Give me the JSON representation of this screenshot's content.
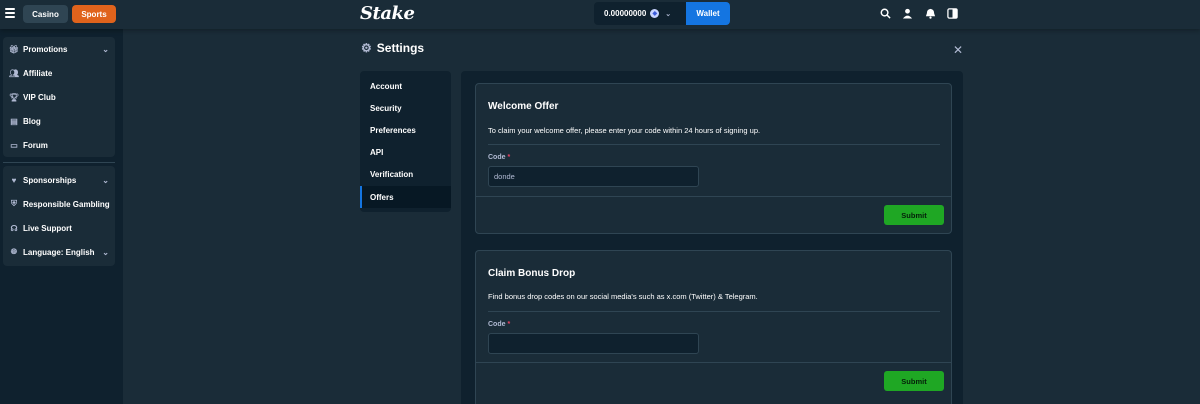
{
  "header": {
    "casino_label": "Casino",
    "sports_label": "Sports",
    "logo_text": "Stake",
    "balance": "0.00000000",
    "wallet_label": "Wallet",
    "accent": "#1475e1",
    "sports_color": "#e0631c"
  },
  "sidebar": {
    "group1": [
      {
        "label": "Promotions",
        "icon": "gift-icon",
        "expandable": true
      },
      {
        "label": "Affiliate",
        "icon": "affiliate-icon",
        "expandable": false
      },
      {
        "label": "VIP Club",
        "icon": "trophy-icon",
        "expandable": false
      },
      {
        "label": "Blog",
        "icon": "blog-icon",
        "expandable": false
      },
      {
        "label": "Forum",
        "icon": "forum-icon",
        "expandable": false
      }
    ],
    "group2": [
      {
        "label": "Sponsorships",
        "icon": "handshake-icon",
        "expandable": true
      },
      {
        "label": "Responsible Gambling",
        "icon": "shield-icon",
        "expandable": false
      },
      {
        "label": "Live Support",
        "icon": "headset-icon",
        "expandable": false
      },
      {
        "label": "Language: English",
        "icon": "globe-icon",
        "expandable": true
      }
    ]
  },
  "settings": {
    "title": "Settings",
    "menu": [
      {
        "label": "Account",
        "active": false
      },
      {
        "label": "Security",
        "active": false
      },
      {
        "label": "Preferences",
        "active": false
      },
      {
        "label": "API",
        "active": false
      },
      {
        "label": "Verification",
        "active": false
      },
      {
        "label": "Offers",
        "active": true
      }
    ]
  },
  "welcome_offer": {
    "title": "Welcome Offer",
    "description": "To claim your welcome offer, please enter your code within 24 hours of signing up.",
    "code_label": "Code",
    "required_mark": "*",
    "code_value": "donde",
    "submit_label": "Submit"
  },
  "bonus_drop": {
    "title": "Claim Bonus Drop",
    "description": "Find bonus drop codes on our social media's such as x.com (Twitter) & Telegram.",
    "code_label": "Code",
    "required_mark": "*",
    "code_value": "",
    "submit_label": "Submit"
  }
}
